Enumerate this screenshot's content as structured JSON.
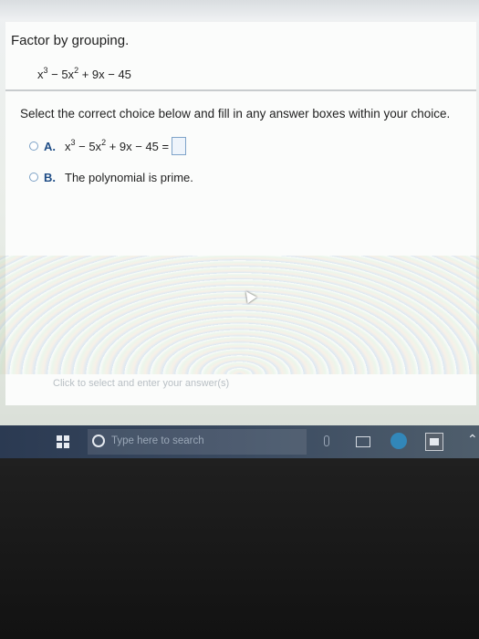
{
  "question": {
    "title": "Factor by grouping.",
    "polynomial": {
      "t1": "x",
      "e1": "3",
      "t2": " − 5x",
      "e2": "2",
      "t3": " + 9x − 45"
    },
    "instruction": "Select the correct choice below and fill in any answer boxes within your choice."
  },
  "choices": {
    "a": {
      "letter": "A.",
      "t1": "x",
      "e1": "3",
      "t2": " − 5x",
      "e2": "2",
      "t3": " + 9x − 45 ="
    },
    "b": {
      "letter": "B.",
      "text": "The polynomial is prime."
    }
  },
  "status_hint": "Click to select and enter your answer(s)",
  "taskbar": {
    "search_placeholder": "Type here to search"
  },
  "colors": {
    "accent": "#1f4d86",
    "taskbar": "#2b3a52"
  }
}
